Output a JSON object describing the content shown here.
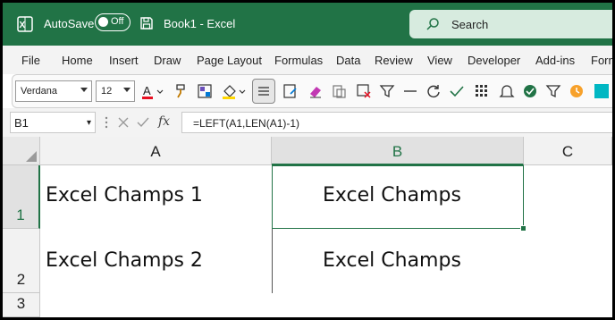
{
  "titlebar": {
    "autosave_label": "AutoSave",
    "autosave_state": "Off",
    "document_title": "Book1  -  Excel",
    "search_placeholder": "Search",
    "brand_color": "#217346"
  },
  "menu": {
    "items": [
      "File",
      "Home",
      "Insert",
      "Draw",
      "Page Layout",
      "Formulas",
      "Data",
      "Review",
      "View",
      "Developer",
      "Add-ins",
      "Form"
    ]
  },
  "ribbon": {
    "font_name": "Verdana",
    "font_size": "12",
    "icons": [
      "font-color-icon",
      "format-painter-icon",
      "styles-icon",
      "fill-color-icon",
      "align-icon",
      "notes-icon",
      "eraser-icon",
      "paste-icon",
      "clear-format-icon",
      "filter-icon",
      "line-icon",
      "refresh-icon",
      "check-icon",
      "grid-icon",
      "bell-icon",
      "badge-icon",
      "funnel-icon",
      "clock-icon",
      "square-icon"
    ]
  },
  "formula_bar": {
    "name_box": "B1",
    "formula": "=LEFT(A1,LEN(A1)-1)"
  },
  "grid": {
    "columns": [
      "A",
      "B",
      "C"
    ],
    "selected_column": "B",
    "rows": [
      "1",
      "2",
      "3"
    ],
    "selected_row": "1",
    "cells": {
      "A1": "Excel Champs 1",
      "B1": "Excel Champs",
      "A2": "Excel Champs 2",
      "B2": "Excel Champs"
    }
  }
}
